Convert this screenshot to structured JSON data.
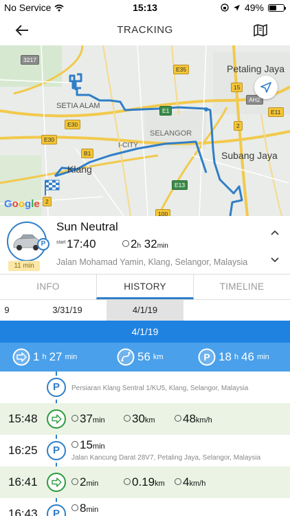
{
  "status": {
    "carrier": "No Service",
    "time": "15:13",
    "battery": "49%",
    "battery_level": 0.49
  },
  "header": {
    "title": "TRACKING",
    "back_icon": "back-arrow-icon",
    "map_icon": "map-icon"
  },
  "map": {
    "labels": {
      "petaling_jaya": "Petaling Jaya",
      "setia_alam": "SETIA ALAM",
      "selangor": "SELANGOR",
      "icity": "I-CITY",
      "klang": "Klang",
      "subang_jaya": "Subang Jaya"
    },
    "shields": {
      "s3217": "3217",
      "e35": "E35",
      "s15": "15",
      "ah2": "AH2",
      "e1a": "E1",
      "e1b": "E1",
      "e11": "E11",
      "e30a": "E30",
      "e30b": "E30",
      "b1": "B1",
      "s2a": "2",
      "s2b": "2",
      "e13": "E13",
      "s100": "100"
    },
    "google": "Google"
  },
  "vehicle": {
    "name": "Sun Neutral",
    "start_label": "start",
    "start_time": "17:40",
    "duration_h": "2",
    "duration_h_unit": "h",
    "duration_m": "32",
    "duration_m_unit": "min",
    "address": "Jalan Mohamad Yamin, Klang, Selangor, Malaysia",
    "badge": "11 min",
    "parking_badge": "P"
  },
  "tabs": [
    {
      "label": "INFO"
    },
    {
      "label": "HISTORY"
    },
    {
      "label": "TIMELINE"
    }
  ],
  "dates": [
    "9",
    "3/31/19",
    "4/1/19"
  ],
  "day": {
    "title": "4/1/19",
    "summary": {
      "drive_h": "1",
      "drive_h_unit": "h",
      "drive_m": "27",
      "drive_m_unit": "min",
      "distance": "56",
      "distance_unit": "km",
      "park_h": "18",
      "park_h_unit": "h",
      "park_m": "46",
      "park_m_unit": "min"
    }
  },
  "timeline": [
    {
      "type": "park",
      "address": "Persiaran Klang Sentral 1/KU5, Klang, Selangor, Malaysia"
    },
    {
      "type": "drive",
      "time": "15:48",
      "duration": "37",
      "duration_unit": "min",
      "distance": "30",
      "distance_unit": "km",
      "speed": "48",
      "speed_unit": "km/h"
    },
    {
      "type": "park",
      "time": "16:25",
      "duration": "15",
      "duration_unit": "min",
      "address": "Jalan Kancung Darat 28V7, Petaling Jaya, Selangor, Malaysia"
    },
    {
      "type": "drive",
      "time": "16:41",
      "duration": "2",
      "duration_unit": "min",
      "distance": "0.19",
      "distance_unit": "km",
      "speed": "4",
      "speed_unit": "km/h"
    },
    {
      "type": "park",
      "time": "16:43",
      "duration": "8",
      "duration_unit": "min"
    }
  ],
  "colors": {
    "accent": "#2f7ec8",
    "day_header": "#1f82e0",
    "summary": "#4aa0ea",
    "trip_row": "#eaf3e4",
    "drive_icon": "#2e9a3c",
    "route": "#2f7ec8"
  }
}
